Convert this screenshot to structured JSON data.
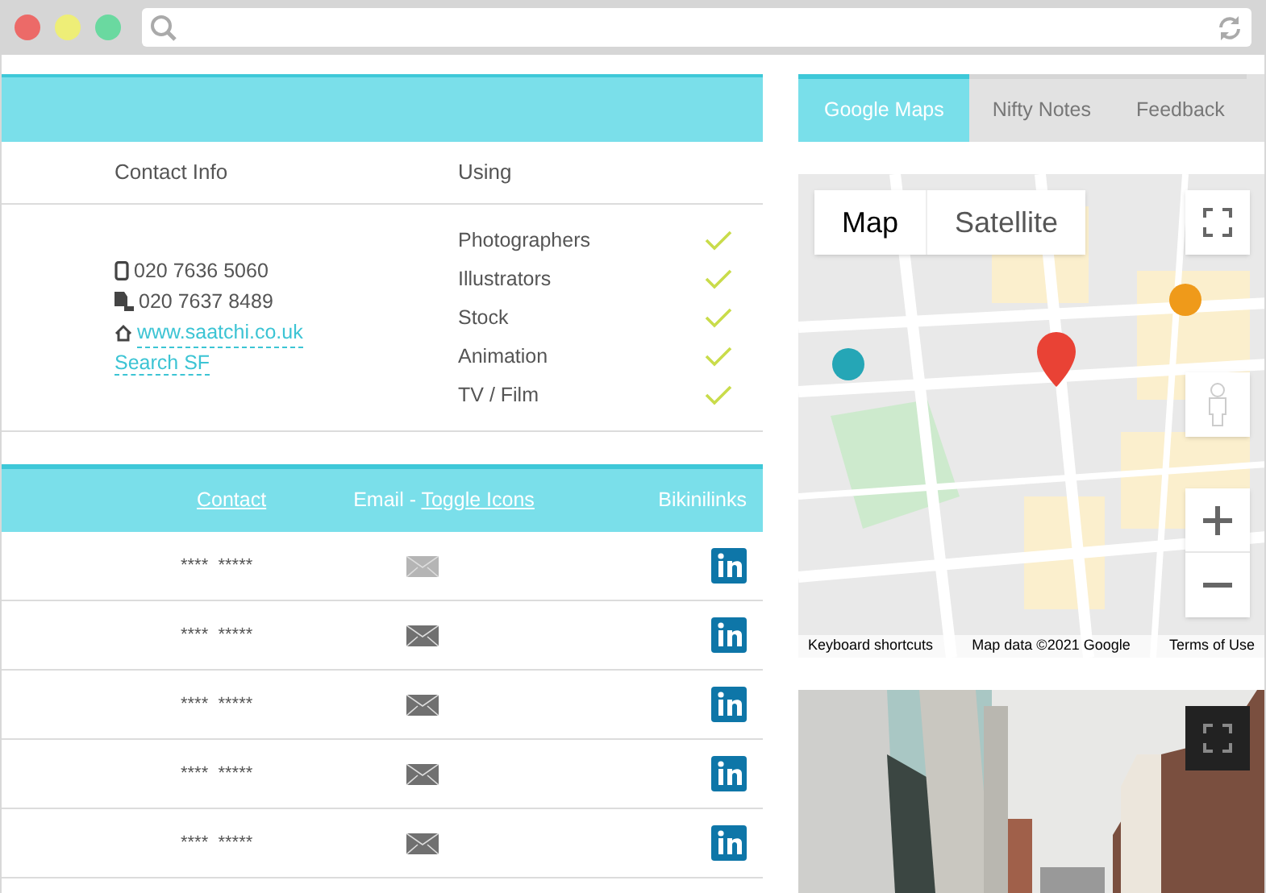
{
  "contact_table": {
    "columns": [
      {
        "label": "Contact Info"
      },
      {
        "label": "Using"
      }
    ],
    "contact": {
      "phone": "020 7636 5060",
      "fax": "020 7637 8489",
      "website": "www.saatchi.co.uk",
      "search_link": "Search SF"
    },
    "using": [
      {
        "label": "Photographers",
        "checked": true
      },
      {
        "label": "Illustrators",
        "checked": true
      },
      {
        "label": "Stock",
        "checked": true
      },
      {
        "label": "Animation",
        "checked": true
      },
      {
        "label": "TV / Film",
        "checked": true
      }
    ]
  },
  "people_table": {
    "header": {
      "contact": "Contact",
      "email_prefix": "Email - ",
      "toggle": "Toggle Icons",
      "links": "Bikinilinks"
    },
    "rows": [
      {
        "contact": "****  *****",
        "email_muted": true
      },
      {
        "contact": "****  *****",
        "email_muted": false
      },
      {
        "contact": "****  *****",
        "email_muted": false
      },
      {
        "contact": "****  *****",
        "email_muted": false
      },
      {
        "contact": "****  *****",
        "email_muted": false
      }
    ]
  },
  "tabs": [
    {
      "label": "Google Maps",
      "selected": true
    },
    {
      "label": "Nifty Notes",
      "selected": false
    },
    {
      "label": "Feedback",
      "selected": false
    }
  ],
  "map": {
    "map_types": [
      {
        "label": "Map",
        "selected": true
      },
      {
        "label": "Satellite",
        "selected": false
      }
    ],
    "footer": [
      "Keyboard shortcuts",
      "Map data ©2021 Google",
      "Terms of Use"
    ]
  }
}
